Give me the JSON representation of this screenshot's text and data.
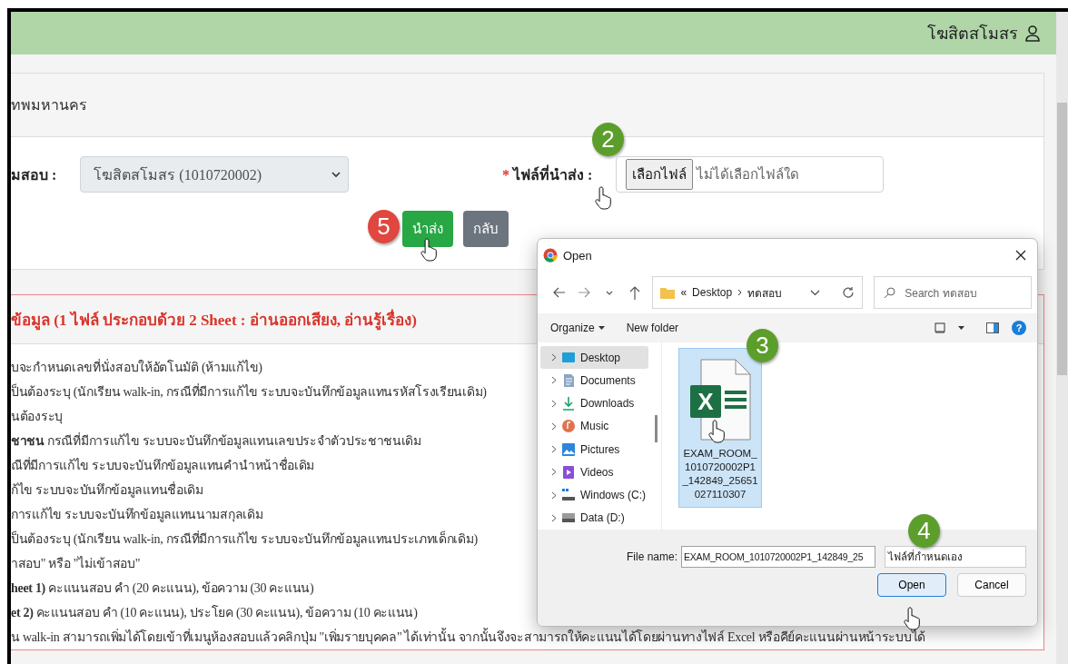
{
  "header": {
    "user_name": "โฆสิตสโมสร"
  },
  "top_card": {
    "text": "ทพมหานคร"
  },
  "form": {
    "room_label": "มสอบ :",
    "room_select": "โฆสิตสโมสร (1010720002)",
    "required_mark": "*",
    "file_label": "ไฟล์ที่นำส่ง :",
    "file_button": "เลือกไฟล์",
    "file_status": "ไม่ได้เลือกไฟล์ใด",
    "buttons": [
      {
        "label": "นำส่ง",
        "kind": "primary"
      },
      {
        "label": "กลับ",
        "kind": "secondary"
      }
    ]
  },
  "instructions": {
    "title": "ข้อมูล (1 ไฟล์ ประกอบด้วย 2 Sheet : อ่านออกเสียง, อ่านรู้เรื่อง)",
    "lines": [
      "บจะกำหนดเลขที่นั่งสอบให้อัตโนมัติ (ห้ามแก้ไข)",
      "ป็นต้องระบุ (นักเรียน walk-in, กรณีที่มีการแก้ไข ระบบจะบันทึกข้อมูลแทนรหัสโรงเรียนเดิม)",
      "นต้องระบุ",
      "**ชาชน** กรณีที่มีการแก้ไข ระบบจะบันทึกข้อมูลแทนเลขประจำตัวประชาชนเดิม",
      "ณีที่มีการแก้ไข ระบบจะบันทึกข้อมูลแทนคำนำหน้าชื่อเดิม",
      "ก้ไข ระบบจะบันทึกข้อมูลแทนชื่อเดิม",
      "การแก้ไข ระบบจะบันทึกข้อมูลแทนนามสกุลเดิม",
      "ป็นต้องระบุ (นักเรียน walk-in, กรณีที่มีการแก้ไข ระบบจะบันทึกข้อมูลแทนประเภทเด็กเดิม)",
      "าสอบ\" หรือ \"ไม่เข้าสอบ\"",
      "**heet 1)** คะแนนสอบ คำ (20 คะแนน), ข้อความ (30 คะแนน)",
      "**et 2)** คะแนนสอบ คำ (10 คะแนน), ประโยค (30 คะแนน), ข้อความ (10 คะแนน)",
      "น walk-in สามารถเพิ่มได้โดยเข้าที่เมนูห้องสอบแล้วคลิกปุ่ม \"เพิ่มรายบุคคล\" ได้เท่านั้น จากนั้นจึงจะสามารถให้คะแนนได้โดยผ่านทางไฟล์ Excel หรือคีย์คะแนนผ่านหน้าระบบได้"
    ]
  },
  "dialog": {
    "title": "Open",
    "path_prefix": "«",
    "path": [
      "Desktop",
      "ทดสอบ"
    ],
    "search_placeholder": "Search ทดสอบ",
    "toolbar": [
      "Organize",
      "New folder"
    ],
    "help": "?",
    "nav": [
      {
        "label": "Desktop",
        "kind": "desktop",
        "selected": true
      },
      {
        "label": "Documents",
        "kind": "documents",
        "selected": false
      },
      {
        "label": "Downloads",
        "kind": "downloads",
        "selected": false
      },
      {
        "label": "Music",
        "kind": "music",
        "selected": false
      },
      {
        "label": "Pictures",
        "kind": "pictures",
        "selected": false
      },
      {
        "label": "Videos",
        "kind": "videos",
        "selected": false
      },
      {
        "label": "Windows (C:)",
        "kind": "system-drive",
        "selected": false
      },
      {
        "label": "Data (D:)",
        "kind": "drive",
        "selected": false
      }
    ],
    "files": [
      {
        "name": "EXAM_ROOM_1010720002P1_142849_25651027110307",
        "icon_letter": "X",
        "selected": true
      }
    ],
    "file_name_label": "File name:",
    "file_name": "EXAM_ROOM_1010720002P1_142849_25",
    "file_type": "ไฟล์ที่กำหนดเอง",
    "buttons": [
      {
        "label": "Open",
        "default": true
      },
      {
        "label": "Cancel",
        "default": false
      }
    ]
  },
  "step_badges": [
    {
      "label": "2",
      "color": "#5c9e2b"
    },
    {
      "label": "5",
      "color": "#e0473f"
    },
    {
      "label": "3",
      "color": "#5c9e2b"
    },
    {
      "label": "4",
      "color": "#5c9e2b"
    }
  ]
}
